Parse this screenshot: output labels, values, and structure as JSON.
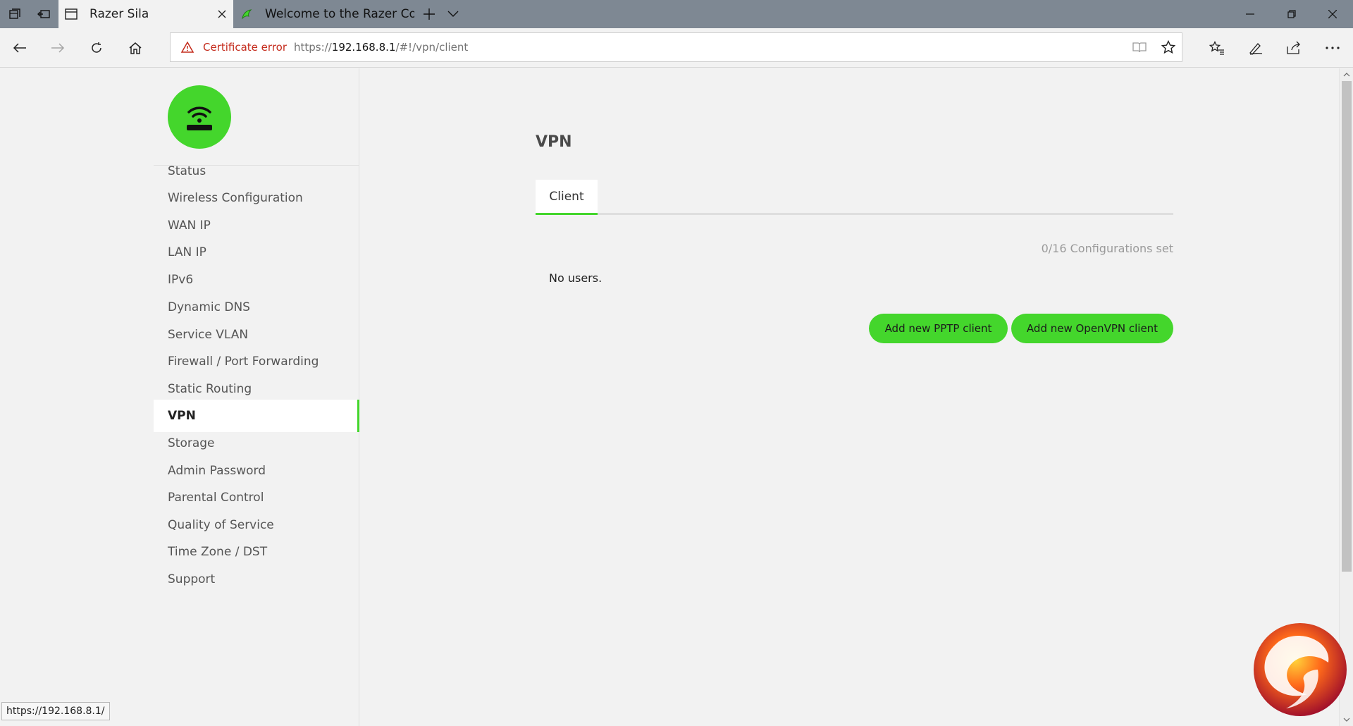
{
  "browser": {
    "tabs": [
      {
        "title": "Razer Sila",
        "active": true,
        "icon": "page-icon"
      },
      {
        "title": "Welcome to the Razer Com",
        "active": false,
        "icon": "razer-snake-icon"
      }
    ],
    "address": {
      "cert_warning": "Certificate error",
      "url_protocol": "https://",
      "url_host": "192.168.8.1",
      "url_path": "/#!/vpn/client"
    },
    "status_bar_url": "https://192.168.8.1/"
  },
  "sidebar": {
    "logo_icon": "wifi-router-icon",
    "items": [
      {
        "label": "Status",
        "active": false
      },
      {
        "label": "Wireless Configuration",
        "active": false
      },
      {
        "label": "WAN IP",
        "active": false
      },
      {
        "label": "LAN IP",
        "active": false
      },
      {
        "label": "IPv6",
        "active": false
      },
      {
        "label": "Dynamic DNS",
        "active": false
      },
      {
        "label": "Service VLAN",
        "active": false
      },
      {
        "label": "Firewall / Port Forwarding",
        "active": false
      },
      {
        "label": "Static Routing",
        "active": false
      },
      {
        "label": "VPN",
        "active": true
      },
      {
        "label": "Storage",
        "active": false
      },
      {
        "label": "Admin Password",
        "active": false
      },
      {
        "label": "Parental Control",
        "active": false
      },
      {
        "label": "Quality of Service",
        "active": false
      },
      {
        "label": "Time Zone / DST",
        "active": false
      },
      {
        "label": "Support",
        "active": false
      }
    ]
  },
  "main": {
    "title": "VPN",
    "tabs": [
      {
        "label": "Client",
        "active": true
      }
    ],
    "config_count": "0/16 Configurations set",
    "empty_message": "No users.",
    "buttons": {
      "add_pptp": "Add new PPTP client",
      "add_openvpn": "Add new OpenVPN client"
    }
  },
  "colors": {
    "accent": "#44d62c",
    "cert_error": "#c42b1c",
    "tabstrip": "#7e8893"
  }
}
